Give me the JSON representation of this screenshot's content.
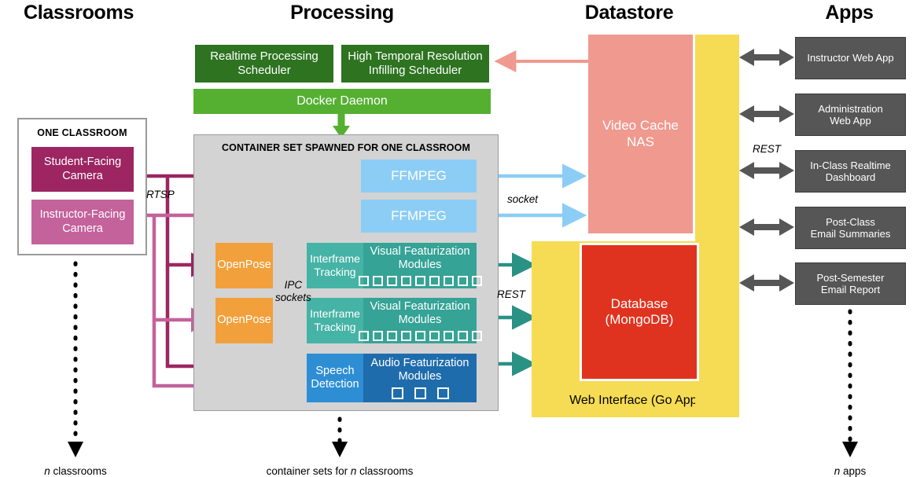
{
  "columns": [
    {
      "title": "Classrooms"
    },
    {
      "title": "Processing"
    },
    {
      "title": "Datastore"
    },
    {
      "title": "Apps"
    }
  ],
  "processing": {
    "schedulers": [
      {
        "label": "Realtime Processing\nScheduler"
      },
      {
        "label": "High Temporal Resolution\nInfilling Scheduler"
      }
    ],
    "docker_daemon": "Docker Daemon",
    "container_set_label": "CONTAINER SET SPAWNED FOR ONE CLASSROOM",
    "ffmpeg": [
      "FFMPEG",
      "FFMPEG"
    ],
    "openpose": [
      "OpenPose",
      "OpenPose"
    ],
    "interframe": [
      "Interframe\nTracking",
      "Interframe\nTracking"
    ],
    "visual_featurization": [
      {
        "label": "Visual Featurization\nModules",
        "module_count": 9
      },
      {
        "label": "Visual Featurization\nModules",
        "module_count": 9
      }
    ],
    "speech_detection": "Speech\nDetection",
    "audio_featurization": {
      "label": "Audio Featurization\nModules",
      "module_count": 3
    }
  },
  "classrooms": {
    "frame_label": "ONE CLASSROOM",
    "cameras": [
      {
        "label": "Student-Facing\nCamera",
        "color": "#9c2562"
      },
      {
        "label": "Instructor-Facing\nCamera",
        "color": "#c4629c"
      }
    ]
  },
  "datastore": {
    "video_cache": "Video Cache\nNAS",
    "database": "Database\n(MongoDB)",
    "web_interface": "Web Interface (Go App)"
  },
  "apps": [
    {
      "label": "Instructor Web App"
    },
    {
      "label": "Administration\nWeb App"
    },
    {
      "label": "In-Class Realtime\nDashboard"
    },
    {
      "label": "Post-Class\nEmail Summaries"
    },
    {
      "label": "Post-Semester\nEmail Report"
    }
  ],
  "edge_labels": {
    "rtsp": "RTSP",
    "ipc_sockets": "IPC\nsockets",
    "socket": "socket",
    "rest_datastore": "REST",
    "rest_apps": "REST"
  },
  "footers": [
    {
      "prefix": "",
      "italic": "n",
      "suffix": " classrooms"
    },
    {
      "prefix": "container sets for ",
      "italic": "n",
      "suffix": " classrooms"
    },
    {
      "prefix": "",
      "italic": "n",
      "suffix": " apps"
    }
  ],
  "colors": {
    "scheduler_green": "#2d7320",
    "docker_green": "#55b032",
    "container_gray": "#d3d3d3",
    "camera_dark": "#9c2562",
    "camera_light": "#c4629c",
    "ffmpeg_blue": "#8ccdf5",
    "openpose_orange": "#f2a03c",
    "interframe_teal": "#45b3a5",
    "visual_teal": "#35a396",
    "speech_blue": "#2e8ed4",
    "audio_blue": "#1f6cac",
    "video_cache_pink": "#f0998f",
    "database_red": "#e0331f",
    "web_yellow": "#f6dc54",
    "app_gray": "#565656",
    "arrow_dark_magenta": "#9c2562",
    "arrow_light_magenta": "#c4629c",
    "arrow_orange": "#f2a03c",
    "arrow_blue": "#8ccdf5",
    "arrow_teal": "#2a9185",
    "arrow_pink": "#f0998f",
    "arrow_green": "#55b032",
    "arrow_gray": "#565656"
  }
}
